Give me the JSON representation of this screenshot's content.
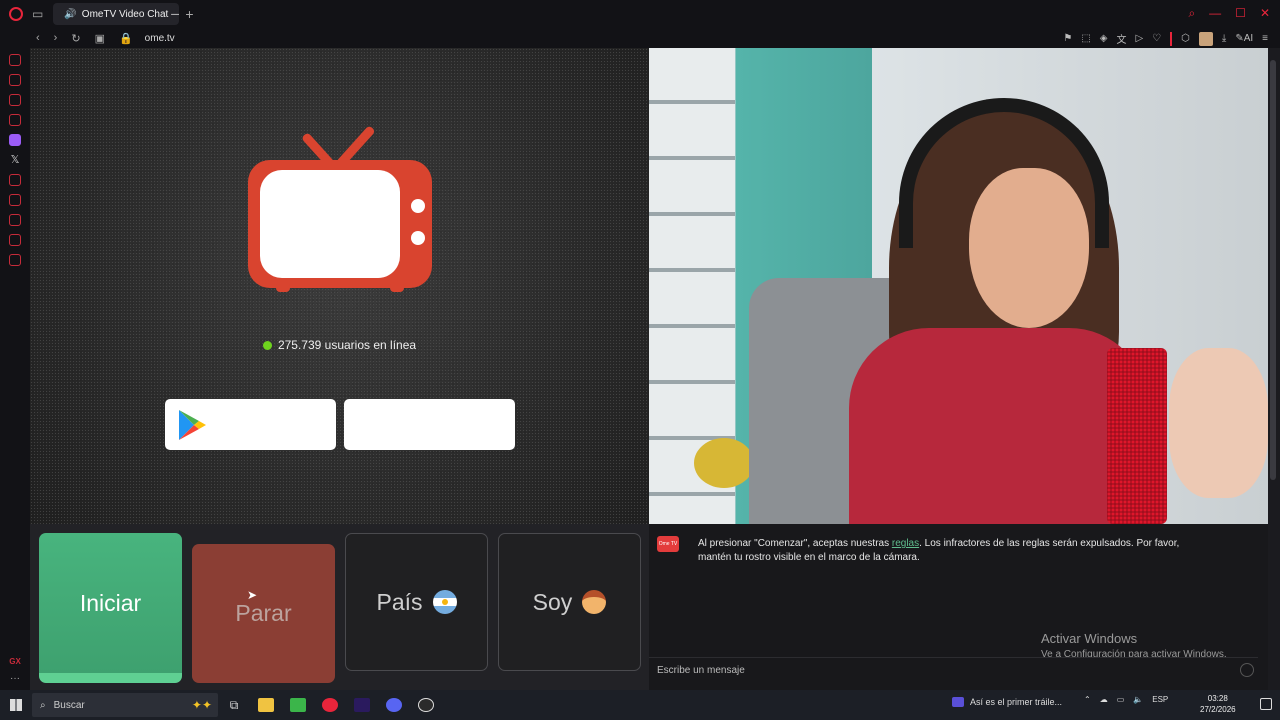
{
  "browser": {
    "tab_title": "OmeTV Video Chat — C",
    "url": "ome.tv"
  },
  "site": {
    "online_count": "275.739 usuarios en línea",
    "buttons": {
      "start": "Iniciar",
      "stop": "Parar",
      "country": "País",
      "gender": "Soy"
    },
    "chat": {
      "logo_text": "Ome TV",
      "message_before_link": "Al presionar \"Comenzar\", aceptas nuestras ",
      "message_link": "reglas",
      "message_after_link": ". Los infractores de las reglas serán expulsados. Por favor, mantén tu rostro visible en el marco de la cámara.",
      "input_placeholder": "Escribe un mensaje"
    },
    "colors": {
      "accent_red": "#e33c3c",
      "start_green": "#48b47e",
      "stop_red": "#8b3e34",
      "online_dot": "#6ed31e",
      "link_green": "#5fbd8d"
    }
  },
  "windows_overlay": {
    "title": "Activar Windows",
    "subtitle": "Ve a Configuración para activar Windows."
  },
  "taskbar": {
    "search_label": "Buscar",
    "media_title": "Así es el primer tráile...",
    "language": "ESP",
    "time": "03:28",
    "date": "27/2/2026"
  }
}
